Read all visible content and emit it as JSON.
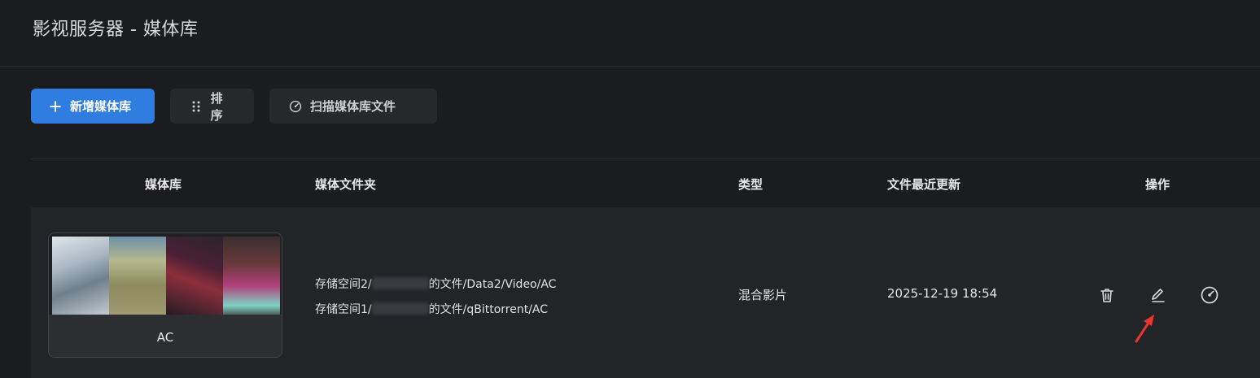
{
  "header": {
    "title": "影视服务器 - 媒体库"
  },
  "toolbar": {
    "add_label": "新增媒体库",
    "sort_label": "排序",
    "scan_label": "扫描媒体库文件"
  },
  "table": {
    "columns": {
      "library": "媒体库",
      "folders": "媒体文件夹",
      "type": "类型",
      "updated": "文件最近更新",
      "actions": "操作"
    },
    "rows": [
      {
        "name": "AC",
        "folders": [
          {
            "prefix": "存储空间2/",
            "suffix": "的文件/Data2/Video/AC"
          },
          {
            "prefix": "存储空间1/",
            "suffix": "的文件/qBittorrent/AC"
          }
        ],
        "type": "混合影片",
        "updated": "2025-12-19 18:54",
        "actions": [
          "trash-icon",
          "edit-icon",
          "scan-icon"
        ]
      }
    ]
  },
  "colors": {
    "background": "#1b1c1f",
    "row_background": "#232428",
    "primary": "#2f7de1",
    "annotation_arrow": "#e8362d"
  }
}
